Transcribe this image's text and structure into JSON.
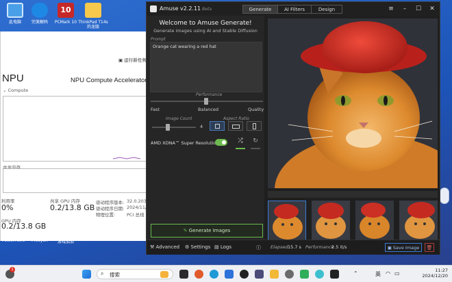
{
  "desktop": {
    "icons": [
      "此电脑",
      "完美解码",
      "PCMark 10",
      "ThinkPad T14s的龙版"
    ]
  },
  "task_manager": {
    "run_task": "运行新任务",
    "title": "NPU",
    "device": "NPU Compute Accelerator D",
    "compute_label": "Compute",
    "shared_label": "共享内存",
    "util_label": "利用率",
    "util_value": "0%",
    "shared_mem_label": "共享 GPU 内存",
    "shared_mem_value": "0.2/13.8 GB",
    "driver_version_label": "驱动程序版本:",
    "driver_version_value": "32.0.203.2",
    "driver_date_label": "驱动程序日期:",
    "driver_date_value": "2024/11/",
    "location_label": "物理位置:",
    "location_value": "PCI 总线 1",
    "gpu_mem_label": "GPU 内存",
    "gpu_mem_value": "0.2/13.8 GB"
  },
  "desktop_bottom_labels": [
    "PowerPoint",
    "Procyon",
    "游戏加加"
  ],
  "amuse": {
    "title": "Amuse v2.2.11",
    "beta": "Beta",
    "tabs": [
      "Generate",
      "AI Filters",
      "Design"
    ],
    "welcome_title": "Welcome to Amuse Generate!",
    "welcome_sub": "Generate images using AI and Stable Diffusion",
    "prompt_label": "Prompt",
    "prompt_text": "Orange cat wearing a red hat",
    "performance_label": "Performance",
    "perf_fast": "Fast",
    "perf_balanced": "Balanced",
    "perf_quality": "Quality",
    "image_count_label": "Image Count",
    "image_count_value": "4",
    "aspect_ratio_label": "Aspect Ratio",
    "super_res_label": "AMD XDNA™ Super Resolution",
    "generate_label": "Generate Images",
    "bottom": {
      "advanced": "Advanced",
      "settings": "Settings",
      "logs": "Logs",
      "elapsed_label": "Elapsed",
      "elapsed_value": "15.7 s",
      "performance_label": "Performance",
      "performance_value": "2.5 it/s",
      "save_label": "Save Image"
    }
  },
  "taskbar": {
    "search_placeholder": "搜索",
    "ime": "英",
    "time": "11:27",
    "date": "2024/12/20",
    "notification_count": "1"
  },
  "colors": {
    "accent_green": "#6dbb4f",
    "accent_blue": "#3b7bd6",
    "amuse_bg": "#1f1f1f"
  }
}
